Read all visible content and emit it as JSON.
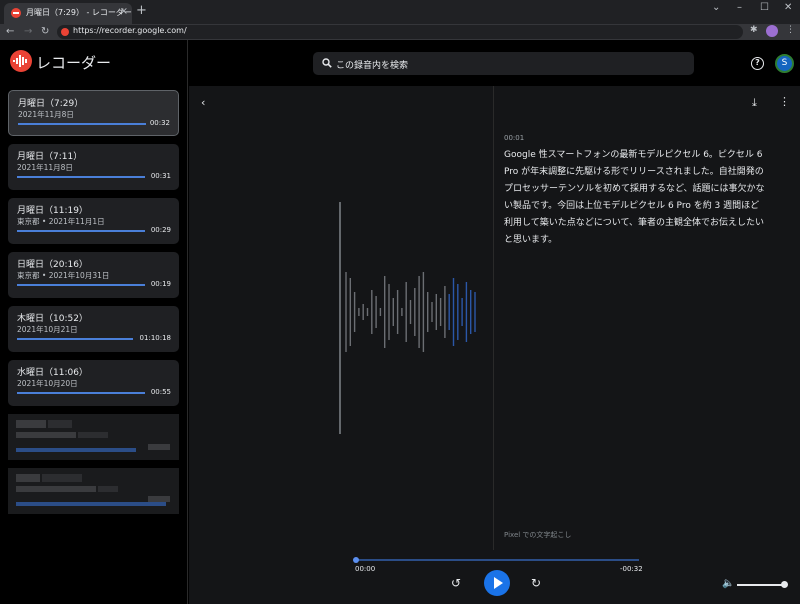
{
  "browser": {
    "tab_title": "月曜日（7:29） - レコーダー",
    "tab_close": "×",
    "new_tab": "+",
    "url": "https://recorder.google.com/",
    "window_controls": [
      "⌄",
      "–",
      "☐",
      "✕"
    ],
    "nav": [
      "←",
      "→",
      "↻"
    ]
  },
  "app": {
    "brand": "レコーダー",
    "search_placeholder": "この録音内を検索",
    "avatar_letter": "S",
    "help_label": "?"
  },
  "recordings": [
    {
      "title": "月曜日（7:29）",
      "subtitle": "2021年11月8日",
      "duration": "00:32",
      "progress": 1.0
    },
    {
      "title": "月曜日（7:11）",
      "subtitle": "2021年11月8日",
      "duration": "00:31",
      "progress": 1.0
    },
    {
      "title": "月曜日（11:19）",
      "subtitle": "東京都 • 2021年11月1日",
      "duration": "00:29",
      "progress": 1.0
    },
    {
      "title": "日曜日（20:16）",
      "subtitle": "東京都 • 2021年10月31日",
      "duration": "00:19",
      "progress": 1.0
    },
    {
      "title": "木曜日（10:52）",
      "subtitle": "2021年10月21日",
      "duration": "01:10:18",
      "progress": 1.0
    },
    {
      "title": "水曜日（11:06）",
      "subtitle": "2021年10月20日",
      "duration": "00:55",
      "progress": 1.0
    }
  ],
  "transcript": {
    "timestamp": "00:01",
    "text": "Google 性スマートフォンの最新モデルピクセル 6。ピクセル 6 Pro が年末調整に先駆ける形でリリースされました。自社開発のプロセッサーテンソルを初めて採用するなど、話題には事欠かない製品です。今回は上位モデルピクセル 6 Pro を約 3 週間ほど利用して築いた点などについて、筆者の主観全体でお伝えしたいと思います。",
    "credit": "Pixel での文字起こし"
  },
  "player": {
    "current_time": "00:00",
    "remaining_time": "-00:32",
    "position": 0.0,
    "volume": 1.0
  },
  "colors": {
    "accent": "#1a73e8",
    "brand": "#ea4335",
    "waveform_played": "#2b57a8",
    "waveform_unplayed": "#6b6e73"
  }
}
